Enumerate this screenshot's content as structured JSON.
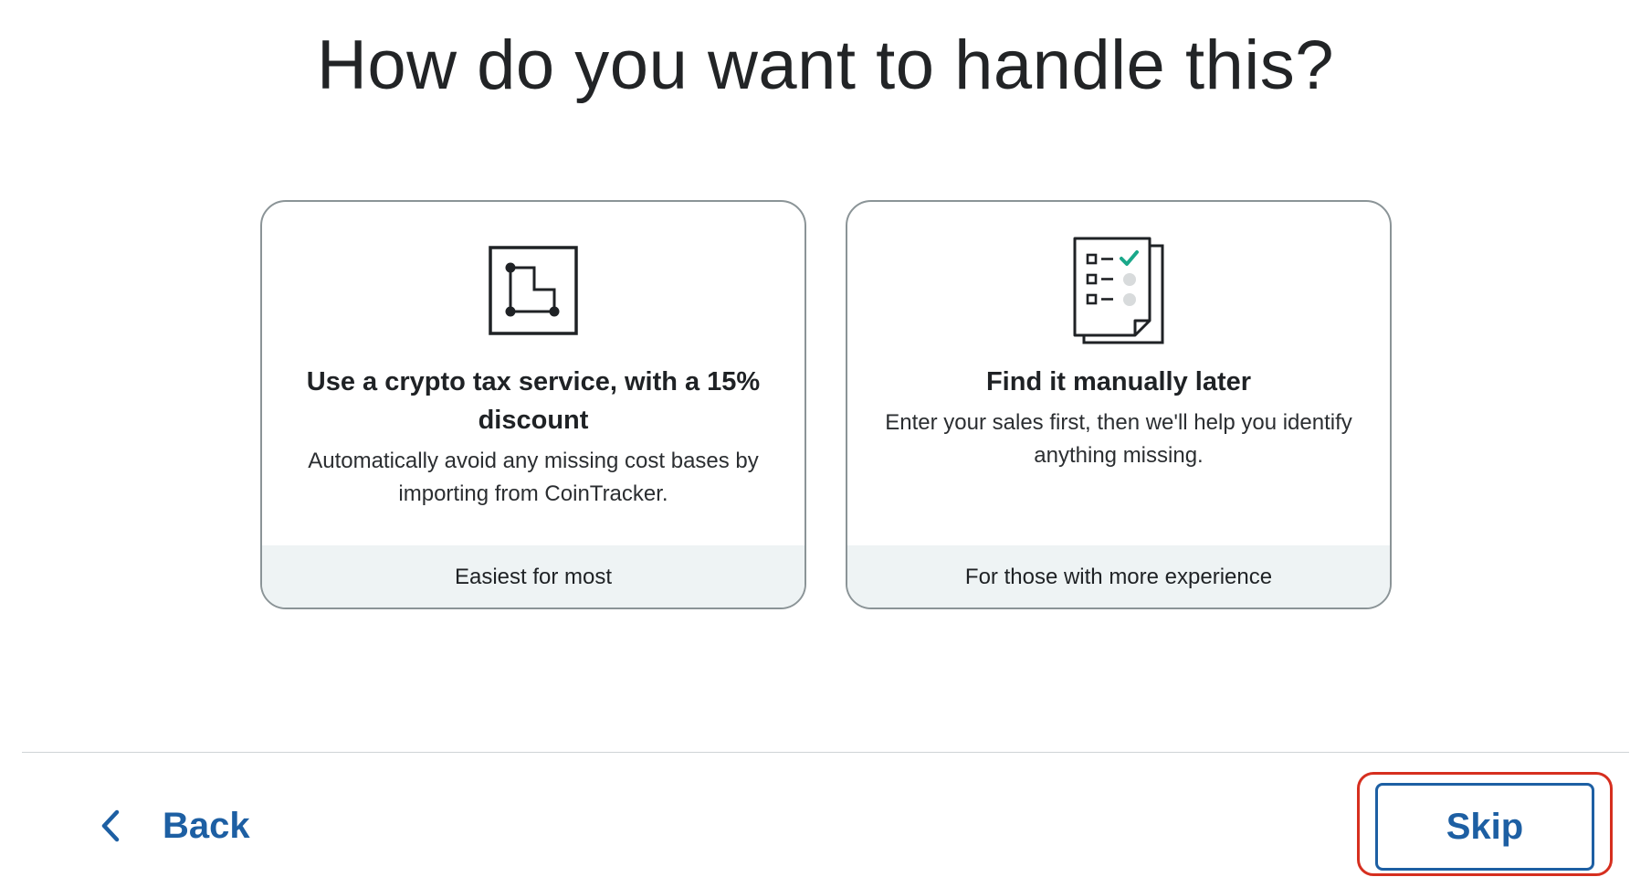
{
  "page": {
    "title": "How do you want to handle this?"
  },
  "options": [
    {
      "title": "Use a crypto tax service, with a 15% discount",
      "description": "Automatically avoid any missing cost bases by importing from CoinTracker.",
      "footer": "Easiest for most",
      "icon": "path-diagram-icon"
    },
    {
      "title": "Find it manually later",
      "description": "Enter your sales first, then we'll help you identify anything missing.",
      "footer": "For those with more experience",
      "icon": "checklist-document-icon"
    }
  ],
  "nav": {
    "back_label": "Back",
    "skip_label": "Skip"
  },
  "colors": {
    "accent": "#1d5fa3",
    "check": "#1aa88a",
    "focus_ring": "#d62f1f",
    "card_border": "#8b9497",
    "card_footer_bg": "#eef3f4"
  }
}
